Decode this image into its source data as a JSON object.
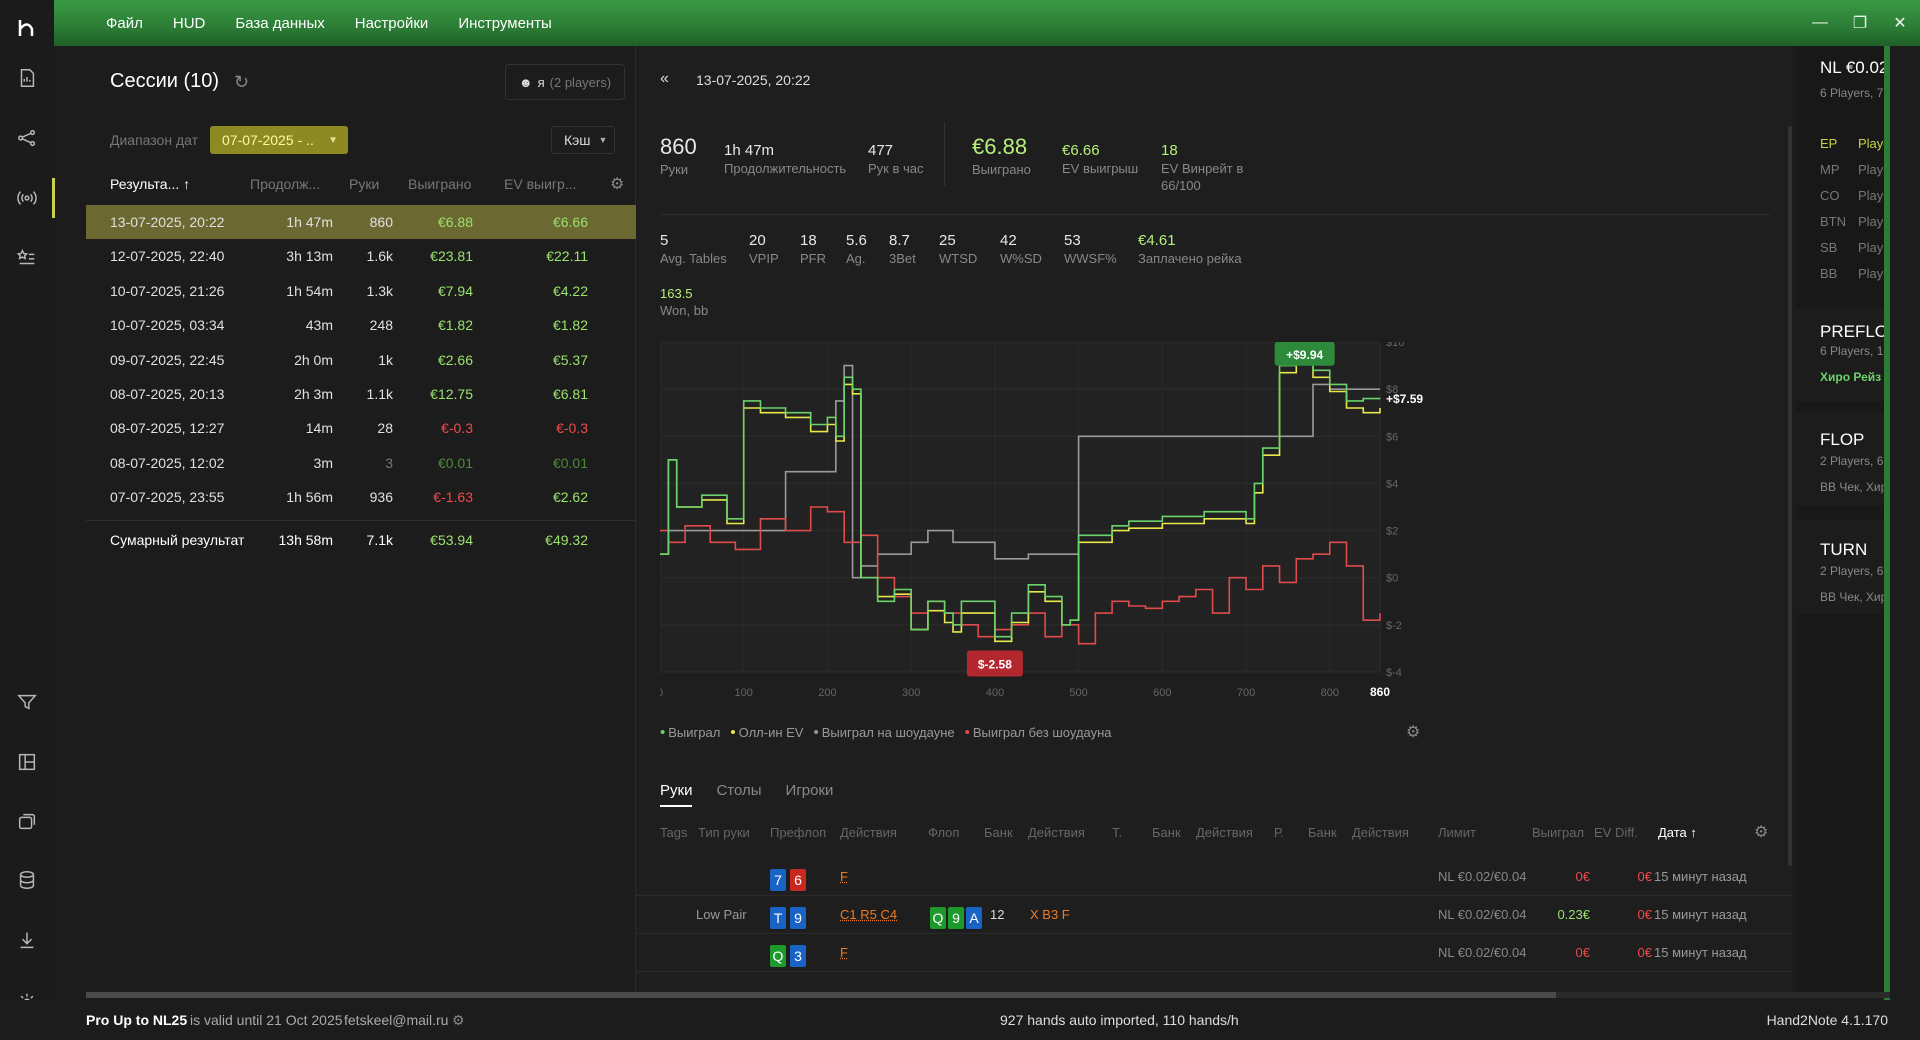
{
  "menu": [
    "Файл",
    "HUD",
    "База данных",
    "Настройки",
    "Инструменты"
  ],
  "window_buttons": [
    "—",
    "❐",
    "✕"
  ],
  "sessions": {
    "title": "Сессии (10)",
    "players_button": "я",
    "players_count": "(2 players)",
    "date_label": "Диапазон дат",
    "date_value": "07-07-2025 - ..",
    "cash_label": "Кэш",
    "headers": [
      "Результа...",
      "Продолж...",
      "Руки",
      "Выиграно",
      "EV выигр..."
    ],
    "rows": [
      {
        "date": "13-07-2025, 20:22",
        "dur": "1h 47m",
        "hands": "860",
        "won": "€6.88",
        "ev": "€6.66",
        "won_sign": "pos",
        "ev_sign": "pos"
      },
      {
        "date": "12-07-2025, 22:40",
        "dur": "3h 13m",
        "hands": "1.6k",
        "won": "€23.81",
        "ev": "€22.11",
        "won_sign": "pos",
        "ev_sign": "pos"
      },
      {
        "date": "10-07-2025, 21:26",
        "dur": "1h 54m",
        "hands": "1.3k",
        "won": "€7.94",
        "ev": "€4.22",
        "won_sign": "pos",
        "ev_sign": "pos"
      },
      {
        "date": "10-07-2025, 03:34",
        "dur": "43m",
        "hands": "248",
        "won": "€1.82",
        "ev": "€1.82",
        "won_sign": "pos",
        "ev_sign": "pos"
      },
      {
        "date": "09-07-2025, 22:45",
        "dur": "2h 0m",
        "hands": "1k",
        "won": "€2.66",
        "ev": "€5.37",
        "won_sign": "pos",
        "ev_sign": "pos"
      },
      {
        "date": "08-07-2025, 20:13",
        "dur": "2h 3m",
        "hands": "1.1k",
        "won": "€12.75",
        "ev": "€6.81",
        "won_sign": "pos",
        "ev_sign": "pos"
      },
      {
        "date": "08-07-2025, 12:27",
        "dur": "14m",
        "hands": "28",
        "won": "€-0.3",
        "ev": "€-0.3",
        "won_sign": "neg",
        "ev_sign": "neg"
      },
      {
        "date": "08-07-2025, 12:02",
        "dur": "3m",
        "hands": "3",
        "won": "€0.01",
        "ev": "€0.01",
        "won_sign": "dim",
        "ev_sign": "dim"
      },
      {
        "date": "07-07-2025, 23:55",
        "dur": "1h 56m",
        "hands": "936",
        "won": "€-1.63",
        "ev": "€2.62",
        "won_sign": "neg",
        "ev_sign": "pos"
      }
    ],
    "summary": {
      "label": "Сумарный результат",
      "dur": "13h 58m",
      "hands": "7.1k",
      "won": "€53.94",
      "ev": "€49.32"
    }
  },
  "session_detail": {
    "date": "13-07-2025, 20:22",
    "stats_top": [
      {
        "v": "860",
        "l": "Руки"
      },
      {
        "v": "1h 47m",
        "l": "Продолжительность"
      },
      {
        "v": "477",
        "l": "Рук в час"
      },
      {
        "v": "€6.88",
        "l": "Выиграно"
      },
      {
        "v": "€6.66",
        "l": "EV выигрыш"
      },
      {
        "v": "18",
        "l": "EV Винрейт в",
        "l2": "66/100"
      }
    ],
    "stats_mid": [
      {
        "v": "5",
        "l": "Avg. Tables"
      },
      {
        "v": "20",
        "l": "VPIP"
      },
      {
        "v": "18",
        "l": "PFR"
      },
      {
        "v": "5.6",
        "l": "Ag."
      },
      {
        "v": "8.7",
        "l": "3Bet"
      },
      {
        "v": "25",
        "l": "WTSD"
      },
      {
        "v": "42",
        "l": "W%SD"
      },
      {
        "v": "53",
        "l": "WWSF%"
      },
      {
        "v": "€4.61",
        "l": "Заплачено рейка"
      }
    ],
    "stats_won_bb": {
      "v": "163.5",
      "l": "Won, bb"
    }
  },
  "chart_data": {
    "type": "line",
    "x_ticks": [
      "0",
      "100",
      "200",
      "300",
      "400",
      "500",
      "600",
      "700",
      "800",
      "860"
    ],
    "y_ticks": [
      "$10",
      "$8",
      "$6",
      "$4",
      "$2",
      "$0",
      "$-2",
      "$-4"
    ],
    "ylim": [
      -4,
      10
    ],
    "xlim": [
      0,
      860
    ],
    "max_label": "+$9.94",
    "end_label": "+$7.59",
    "min_label": "$-2.58",
    "legend": [
      "Выиграл",
      "Олл-ин EV",
      "Выиграл на шоудауне",
      "Выиграл без шоудауна"
    ],
    "colors": {
      "won": "#6bd36b",
      "ev": "#e8e84a",
      "sd": "#9a9a9a",
      "nsd": "#e04b4b"
    },
    "series": [
      {
        "name": "Выиграл",
        "x": [
          0,
          10,
          20,
          50,
          80,
          100,
          120,
          150,
          180,
          200,
          210,
          220,
          230,
          240,
          260,
          280,
          300,
          320,
          340,
          350,
          360,
          400,
          420,
          440,
          460,
          480,
          490,
          500,
          540,
          560,
          600,
          650,
          700,
          710,
          720,
          740,
          760,
          780,
          800,
          820,
          840,
          860
        ],
        "values": [
          1,
          5,
          3,
          3.5,
          2.5,
          7.5,
          7.2,
          7.0,
          6.5,
          6.8,
          6.0,
          8.5,
          8.0,
          0,
          -1,
          -0.5,
          -2.2,
          -1.0,
          -1.5,
          -2.0,
          -1.0,
          -2.5,
          -1.5,
          -0.3,
          -0.8,
          -2.0,
          -1.8,
          1.8,
          2.2,
          2.4,
          2.6,
          2.8,
          2.5,
          4,
          5.5,
          9.0,
          9.5,
          8.8,
          8.2,
          7.5,
          7.6,
          7.59
        ]
      },
      {
        "name": "Олл-ин EV",
        "x": [
          0,
          10,
          20,
          50,
          80,
          100,
          120,
          150,
          180,
          200,
          210,
          220,
          230,
          240,
          260,
          280,
          300,
          320,
          340,
          350,
          360,
          400,
          420,
          440,
          460,
          480,
          490,
          500,
          540,
          560,
          600,
          650,
          700,
          710,
          720,
          740,
          760,
          780,
          800,
          820,
          840,
          860
        ],
        "values": [
          1,
          5,
          3,
          3.3,
          2.3,
          7.2,
          7.0,
          6.8,
          6.2,
          6.5,
          5.8,
          8.2,
          7.8,
          0,
          -0.8,
          -0.7,
          -2.2,
          -1.4,
          -1.9,
          -2.3,
          -1.5,
          -2.7,
          -1.9,
          -0.6,
          -1.0,
          -2.0,
          -1.8,
          1.5,
          2.0,
          2.1,
          2.3,
          2.5,
          2.3,
          3.6,
          5.2,
          8.7,
          9.3,
          8.5,
          7.9,
          7.2,
          7.0,
          7.2
        ]
      },
      {
        "name": "Выиграл на шоудауне",
        "x": [
          0,
          10,
          30,
          50,
          100,
          150,
          200,
          210,
          220,
          230,
          240,
          260,
          300,
          320,
          350,
          400,
          440,
          500,
          600,
          700,
          780,
          800,
          860
        ],
        "values": [
          1,
          2,
          2,
          2,
          2,
          4.5,
          4.5,
          7.5,
          9.0,
          0,
          0.5,
          1.0,
          1.5,
          2.0,
          1.5,
          0.8,
          1.0,
          6.0,
          6.0,
          6.0,
          8.2,
          8.0,
          8.0
        ]
      },
      {
        "name": "Выиграл без шоудауна",
        "x": [
          0,
          10,
          30,
          60,
          90,
          120,
          150,
          180,
          200,
          220,
          240,
          260,
          280,
          300,
          320,
          340,
          360,
          380,
          400,
          420,
          440,
          460,
          480,
          500,
          520,
          540,
          560,
          580,
          600,
          620,
          640,
          660,
          680,
          700,
          720,
          740,
          760,
          780,
          800,
          820,
          840,
          860
        ],
        "values": [
          2,
          1.5,
          2.2,
          1.5,
          1.2,
          2.5,
          2.0,
          3.0,
          2.8,
          1.5,
          1.8,
          0,
          -0.8,
          -1.5,
          -1.0,
          -1.5,
          -2.0,
          -2.5,
          -2.2,
          -2.0,
          -1.5,
          -2.5,
          -2.0,
          -2.8,
          -1.5,
          -1.0,
          -1.2,
          -1.3,
          -1.0,
          -0.8,
          -0.5,
          -1.5,
          0,
          -0.5,
          0.5,
          -0.2,
          0.8,
          1.0,
          1.5,
          0.5,
          -1.8,
          -1.5
        ]
      }
    ]
  },
  "hands_tabs": [
    "Руки",
    "Столы",
    "Игроки"
  ],
  "hands_headers": [
    "Tags",
    "Тип руки",
    "Префлоп",
    "Действия",
    "Флоп",
    "Банк",
    "Действия",
    "Т.",
    "Банк",
    "Действия",
    "Р.",
    "Банк",
    "Действия",
    "Лимит",
    "Выиграл",
    "EV Diff.",
    "Дата ↑"
  ],
  "hands": [
    {
      "type": "",
      "pre": [
        [
          "7",
          "b"
        ],
        [
          "6",
          "r"
        ]
      ],
      "pre_act": "F",
      "flop": [],
      "pot": "",
      "flop_act": "",
      "limit": "NL €0.02/€0.04",
      "won": "0€",
      "ev": "0€",
      "date": "15 минут назад",
      "won_pos": false
    },
    {
      "type": "Low Pair",
      "pre": [
        [
          "T",
          "b"
        ],
        [
          "9",
          "b"
        ]
      ],
      "pre_act": "C1 R5 C4",
      "flop": [
        [
          "Q",
          "g"
        ],
        [
          "9",
          "g"
        ],
        [
          "A",
          "b"
        ]
      ],
      "pot": "12",
      "flop_act": "X B3 F",
      "limit": "NL €0.02/€0.04",
      "won": "0.23€",
      "ev": "0€",
      "date": "15 минут назад",
      "won_pos": true
    },
    {
      "type": "",
      "pre": [
        [
          "Q",
          "g"
        ],
        [
          "3",
          "b"
        ]
      ],
      "pre_act": "F",
      "flop": [],
      "pot": "",
      "flop_act": "",
      "limit": "NL €0.02/€0.04",
      "won": "0€",
      "ev": "0€",
      "date": "15 минут назад",
      "won_pos": false
    }
  ],
  "far_panel": {
    "title": "NL €0.02",
    "sub": "6 Players, 7",
    "positions": [
      [
        "EP",
        "Playe"
      ],
      [
        "MP",
        "Playe"
      ],
      [
        "CO",
        "Playe"
      ],
      [
        "BTN",
        "Playe"
      ],
      [
        "SB",
        "Playe"
      ],
      [
        "BB",
        "Playe"
      ]
    ],
    "preflop": {
      "t": "PREFLO",
      "s": "6 Players, 1.",
      "x": "Хиро Рейз"
    },
    "flop": {
      "t": "FLOP",
      "s": "2 Players, 6",
      "x": "BB Чек, Хир"
    },
    "turn": {
      "t": "TURN",
      "s": "2 Players, 6",
      "x": "BB Чек, Хир"
    }
  },
  "status": {
    "plan": "Pro Up to NL25",
    "valid": "is valid until 21 Oct 2025",
    "email": "fetskeel@mail.ru",
    "center": "927 hands auto imported, 110 hands/h",
    "version": "Hand2Note 4.1.170"
  }
}
